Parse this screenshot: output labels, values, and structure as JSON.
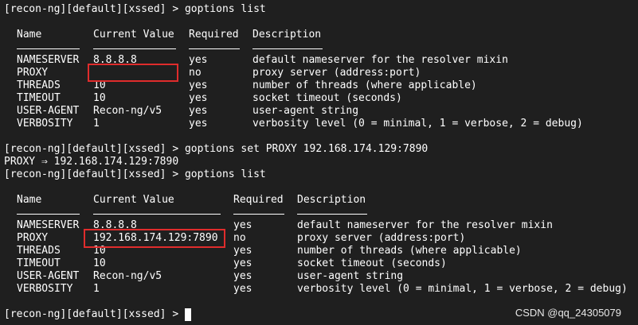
{
  "session": {
    "prompt": "[recon-ng][default][xssed] >",
    "commands": [
      "goptions list",
      "goptions set PROXY 192.168.174.129:7890",
      "goptions list"
    ],
    "set_result": "PROXY ⇒ 192.168.174.129:7890"
  },
  "headers": [
    "Name",
    "Current Value",
    "Required",
    "Description"
  ],
  "table1": [
    [
      "NAMESERVER",
      "8.8.8.8",
      "yes",
      "default nameserver for the resolver mixin"
    ],
    [
      "PROXY",
      "",
      "no",
      "proxy server (address:port)"
    ],
    [
      "THREADS",
      "10",
      "yes",
      "number of threads (where applicable)"
    ],
    [
      "TIMEOUT",
      "10",
      "yes",
      "socket timeout (seconds)"
    ],
    [
      "USER-AGENT",
      "Recon-ng/v5",
      "yes",
      "user-agent string"
    ],
    [
      "VERBOSITY",
      "1",
      "yes",
      "verbosity level (0 = minimal, 1 = verbose, 2 = debug)"
    ]
  ],
  "table2": [
    [
      "NAMESERVER",
      "8.8.8.8",
      "yes",
      "default nameserver for the resolver mixin"
    ],
    [
      "PROXY",
      "192.168.174.129:7890",
      "no",
      "proxy server (address:port)"
    ],
    [
      "THREADS",
      "10",
      "yes",
      "number of threads (where applicable)"
    ],
    [
      "TIMEOUT",
      "10",
      "yes",
      "socket timeout (seconds)"
    ],
    [
      "USER-AGENT",
      "Recon-ng/v5",
      "yes",
      "user-agent string"
    ],
    [
      "VERBOSITY",
      "1",
      "yes",
      "verbosity level (0 = minimal, 1 = verbose, 2 = debug)"
    ]
  ],
  "watermark": "CSDN @qq_24305079",
  "colors": {
    "background": "#1f1f1f",
    "text": "#ffffff",
    "highlight_box": "#e02c2c"
  }
}
